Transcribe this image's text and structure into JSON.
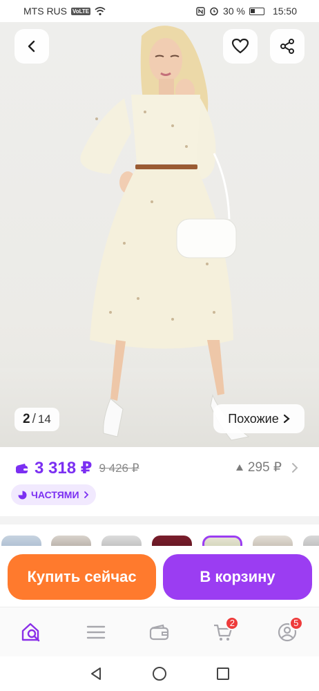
{
  "status_bar": {
    "carrier": "MTS RUS",
    "network_badge": "VoLTE",
    "battery_percent": "30 %",
    "time": "15:50"
  },
  "gallery": {
    "current_index": "2",
    "separator": "/",
    "total": "14",
    "similar_label": "Похожие"
  },
  "price": {
    "current": "3 318 ₽",
    "old": "9 426 ₽",
    "points": "295 ₽",
    "installment_label": "ЧАСТЯМИ"
  },
  "actions": {
    "buy_now_label": "Купить сейчас",
    "to_cart_label": "В корзину"
  },
  "tabs": [
    {
      "icon": "home-search-icon",
      "active": true
    },
    {
      "icon": "catalog-menu-icon",
      "active": false
    },
    {
      "icon": "wallet-icon",
      "active": false
    },
    {
      "icon": "cart-icon",
      "badge": "2"
    },
    {
      "icon": "profile-icon",
      "badge": "5"
    }
  ],
  "colors": {
    "brand_purple": "#7b2ff2",
    "buy_now": "#ff7a2d",
    "to_cart": "#9b3df2",
    "badge_red": "#ee3b3b"
  }
}
